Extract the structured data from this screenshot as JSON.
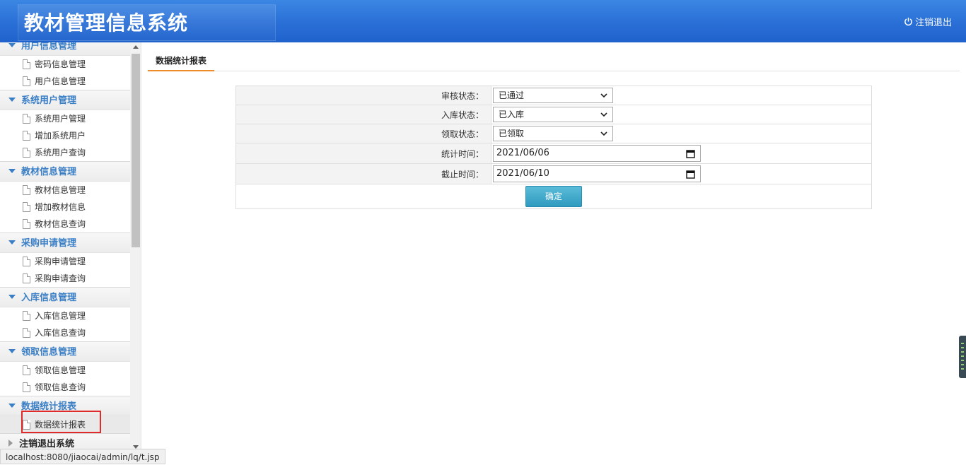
{
  "header": {
    "title": "教材管理信息系统",
    "logout_label": "注销退出"
  },
  "sidebar": {
    "groups": [
      {
        "label": "用户信息管理",
        "items": [
          "密码信息管理",
          "用户信息管理"
        ]
      },
      {
        "label": "系统用户管理",
        "items": [
          "系统用户管理",
          "增加系统用户",
          "系统用户查询"
        ]
      },
      {
        "label": "教材信息管理",
        "items": [
          "教材信息管理",
          "增加教材信息",
          "教材信息查询"
        ]
      },
      {
        "label": "采购申请管理",
        "items": [
          "采购申请管理",
          "采购申请查询"
        ]
      },
      {
        "label": "入库信息管理",
        "items": [
          "入库信息管理",
          "入库信息查询"
        ]
      },
      {
        "label": "领取信息管理",
        "items": [
          "领取信息管理",
          "领取信息查询"
        ]
      },
      {
        "label": "数据统计报表",
        "items": [
          "数据统计报表"
        ]
      },
      {
        "label": "注销退出系统",
        "items": []
      }
    ]
  },
  "main": {
    "tab_label": "数据统计报表",
    "form": {
      "audit_label": "审核状态：",
      "audit_value": "已通过",
      "stock_label": "入库状态：",
      "stock_value": "已入库",
      "receive_label": "领取状态：",
      "receive_value": "已领取",
      "start_label": "统计时间：",
      "start_value": "2021/06/06",
      "end_label": "截止时间：",
      "end_value": "2021/06/10",
      "confirm_label": "确定"
    }
  },
  "status_url": "localhost:8080/jiaocai/admin/lq/t.jsp",
  "colors": {
    "header_blue": "#2a6fd6",
    "accent_orange": "#f08b2a",
    "link_blue": "#3a7fc6",
    "button_teal": "#2f9ac0"
  }
}
